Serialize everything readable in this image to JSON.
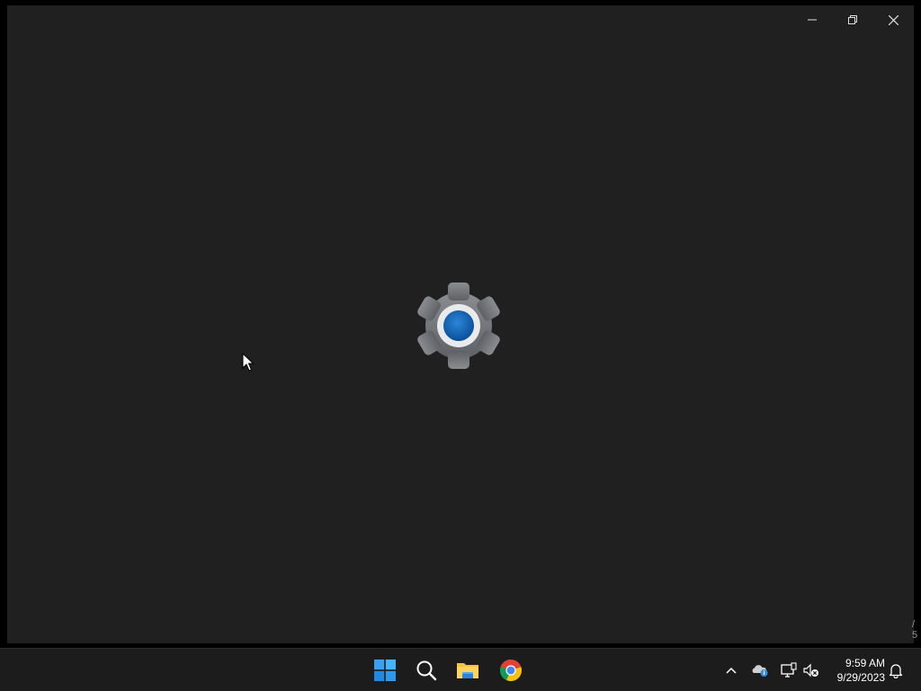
{
  "window": {
    "state": "loading",
    "splash_icon": "settings-gear-icon",
    "caption_buttons": [
      "minimize-icon",
      "restore-icon",
      "close-icon"
    ]
  },
  "taskbar": {
    "pinned": [
      {
        "name": "start",
        "icon": "windows-logo-icon"
      },
      {
        "name": "search",
        "icon": "search-icon"
      },
      {
        "name": "file-explorer",
        "icon": "folder-icon"
      },
      {
        "name": "chrome",
        "icon": "chrome-icon"
      }
    ],
    "tray": {
      "icons": [
        "chevron-up-icon",
        "onedrive-icon",
        "network-icon",
        "volume-muted-icon"
      ],
      "time": "9:59 AM",
      "date": "9/29/2023",
      "notifications_icon": "bell-icon"
    }
  },
  "colors": {
    "window_bg": "#202020",
    "taskbar_bg": "#1c1c1c",
    "accent": "#0f6cbd"
  }
}
